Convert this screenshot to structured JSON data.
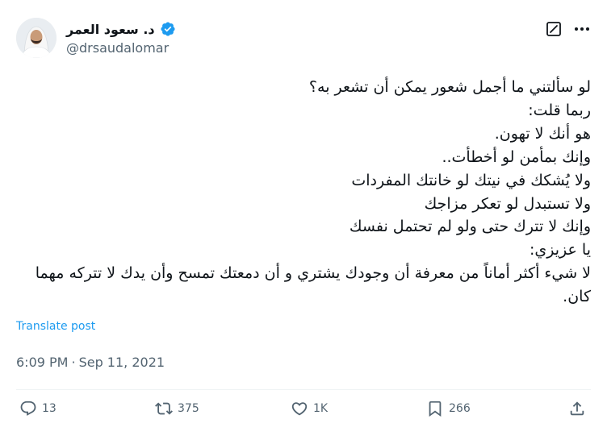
{
  "author": {
    "display_name": "د. سعود العمر",
    "handle": "@drsaudalomar",
    "verified": true
  },
  "tweet": {
    "lines": [
      "لو سألتني ما أجمل شعور يمكن أن تشعر به؟",
      "ربما قلت:",
      "هو أنك لا تهون.",
      "وإنك بمأمن لو أخطأت..",
      "ولا يُشكك في نيتك لو خانتك المفردات",
      "ولا تستبدل لو تعكر مزاجك",
      "وإنك لا تترك حتى ولو لم تحتمل نفسك",
      "يا عزيزي:",
      "لا شيء أكثر أماناً من معرفة أن وجودك يشتري و أن دمعتك تمسح وأن يدك لا تتركه مهما كان."
    ],
    "translate_label": "Translate post",
    "time": "6:09 PM",
    "separator": "·",
    "date": "Sep 11, 2021"
  },
  "actions": {
    "replies": "13",
    "reposts": "375",
    "likes": "1K",
    "bookmarks": "266"
  },
  "colors": {
    "link": "#1d9bf0",
    "secondary_text": "#536471",
    "primary_text": "#0f1419",
    "verified_badge": "#1d9bf0"
  },
  "icons": [
    "verified-badge-icon",
    "grok-icon",
    "more-icon",
    "reply-icon",
    "repost-icon",
    "like-icon",
    "bookmark-icon",
    "share-icon"
  ]
}
